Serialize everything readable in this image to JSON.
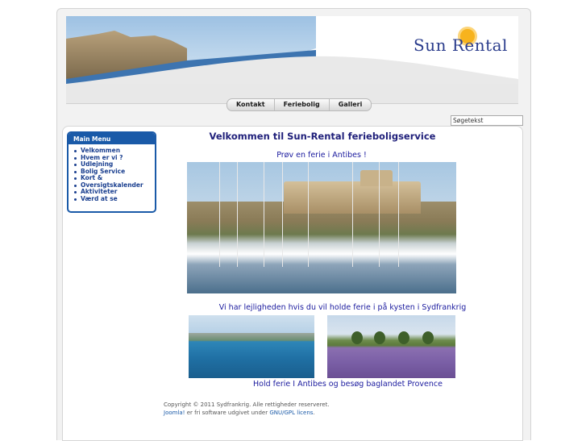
{
  "header": {
    "logo_text": "Sun Rental"
  },
  "topnav": {
    "items": [
      "Kontakt",
      "Feriebolig",
      "Galleri"
    ]
  },
  "search": {
    "value": "Søgetekst"
  },
  "main_menu": {
    "title": "Main Menu",
    "items": [
      "Velkommen",
      "Hvem er vi ?",
      "Udlejning",
      "Bolig Service",
      "Kort &",
      "Oversigtskalender",
      "Aktiviteter",
      "Værd at se"
    ]
  },
  "content": {
    "title": "Velkommen til Sun-Rental ferieboligservice",
    "subtitle": "Prøv en ferie i Antibes !",
    "sea_text": "Vi har lejligheden hvis du vil holde ferie i på kysten i Sydfrankrig",
    "caption": "Hold ferie  I Antibes og besøg baglandet Provence"
  },
  "footer": {
    "copyright": "Copyright © 2011 Sydfrankrig. Alle rettigheder reserveret.",
    "joomla_link": "Joomla!",
    "line2_mid": " er fri software udgivet under ",
    "license_link": "GNU/GPL licens",
    "line2_end": "."
  },
  "colors": {
    "menu_blue": "#1a5aa8",
    "heading_navy": "#1f1f7a",
    "text_blue": "#1a1a9e"
  }
}
